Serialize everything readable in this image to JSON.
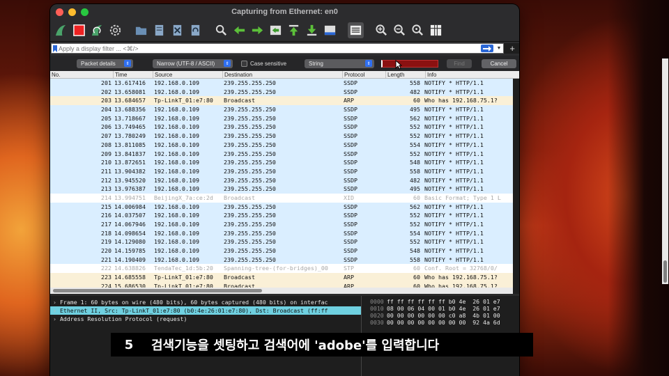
{
  "window": {
    "title": "Capturing from Ethernet: en0"
  },
  "toolbar": {
    "icons": [
      "shark-fin-start-icon",
      "stop-square-icon",
      "shark-fin-restart-icon",
      "gear-options-icon",
      "folder-open-icon",
      "file-save-icon",
      "close-file-icon",
      "reload-icon",
      "search-icon",
      "arrow-back-icon",
      "arrow-forward-icon",
      "go-to-packet-icon",
      "go-first-icon",
      "go-last-icon",
      "autoscroll-icon",
      "colorize-icon",
      "zoom-in-icon",
      "zoom-out-icon",
      "zoom-normal-icon",
      "resize-columns-icon"
    ]
  },
  "filter": {
    "placeholder": "Apply a display filter ... <⌘/>"
  },
  "find": {
    "search_in": "Packet details",
    "encoding": "Narrow (UTF-8 / ASCII)",
    "case_label": "Case sensitive",
    "search_type": "String",
    "find_label": "Find",
    "cancel_label": "Cancel"
  },
  "columns": [
    "No.",
    "Time",
    "Source",
    "Destination",
    "Protocol",
    "Length",
    "Info"
  ],
  "packets": [
    {
      "no": "201",
      "time": "13.617416",
      "src": "192.168.0.109",
      "dst": "239.255.255.250",
      "proto": "SSDP",
      "len": "558",
      "info": "NOTIFY * HTTP/1.1",
      "kind": "udp"
    },
    {
      "no": "202",
      "time": "13.658081",
      "src": "192.168.0.109",
      "dst": "239.255.255.250",
      "proto": "SSDP",
      "len": "482",
      "info": "NOTIFY * HTTP/1.1",
      "kind": "udp"
    },
    {
      "no": "203",
      "time": "13.684657",
      "src": "Tp-LinkT_01:e7:80",
      "dst": "Broadcast",
      "proto": "ARP",
      "len": "60",
      "info": "Who has 192.168.75.1?",
      "kind": "arp"
    },
    {
      "no": "204",
      "time": "13.688356",
      "src": "192.168.0.109",
      "dst": "239.255.255.250",
      "proto": "SSDP",
      "len": "495",
      "info": "NOTIFY * HTTP/1.1",
      "kind": "udp"
    },
    {
      "no": "205",
      "time": "13.718667",
      "src": "192.168.0.109",
      "dst": "239.255.255.250",
      "proto": "SSDP",
      "len": "562",
      "info": "NOTIFY * HTTP/1.1",
      "kind": "udp"
    },
    {
      "no": "206",
      "time": "13.749465",
      "src": "192.168.0.109",
      "dst": "239.255.255.250",
      "proto": "SSDP",
      "len": "552",
      "info": "NOTIFY * HTTP/1.1",
      "kind": "udp"
    },
    {
      "no": "207",
      "time": "13.780249",
      "src": "192.168.0.109",
      "dst": "239.255.255.250",
      "proto": "SSDP",
      "len": "552",
      "info": "NOTIFY * HTTP/1.1",
      "kind": "udp"
    },
    {
      "no": "208",
      "time": "13.811085",
      "src": "192.168.0.109",
      "dst": "239.255.255.250",
      "proto": "SSDP",
      "len": "554",
      "info": "NOTIFY * HTTP/1.1",
      "kind": "udp"
    },
    {
      "no": "209",
      "time": "13.841837",
      "src": "192.168.0.109",
      "dst": "239.255.255.250",
      "proto": "SSDP",
      "len": "552",
      "info": "NOTIFY * HTTP/1.1",
      "kind": "udp"
    },
    {
      "no": "210",
      "time": "13.872651",
      "src": "192.168.0.109",
      "dst": "239.255.255.250",
      "proto": "SSDP",
      "len": "548",
      "info": "NOTIFY * HTTP/1.1",
      "kind": "udp"
    },
    {
      "no": "211",
      "time": "13.904382",
      "src": "192.168.0.109",
      "dst": "239.255.255.250",
      "proto": "SSDP",
      "len": "558",
      "info": "NOTIFY * HTTP/1.1",
      "kind": "udp"
    },
    {
      "no": "212",
      "time": "13.945520",
      "src": "192.168.0.109",
      "dst": "239.255.255.250",
      "proto": "SSDP",
      "len": "482",
      "info": "NOTIFY * HTTP/1.1",
      "kind": "udp"
    },
    {
      "no": "213",
      "time": "13.976387",
      "src": "192.168.0.109",
      "dst": "239.255.255.250",
      "proto": "SSDP",
      "len": "495",
      "info": "NOTIFY * HTTP/1.1",
      "kind": "udp"
    },
    {
      "no": "214",
      "time": "13.994751",
      "src": "BeijingX_7a:ce:2d",
      "dst": "Broadcast",
      "proto": "XID",
      "len": "60",
      "info": "Basic Format; Type 1 L",
      "kind": "gray"
    },
    {
      "no": "215",
      "time": "14.006984",
      "src": "192.168.0.109",
      "dst": "239.255.255.250",
      "proto": "SSDP",
      "len": "562",
      "info": "NOTIFY * HTTP/1.1",
      "kind": "udp"
    },
    {
      "no": "216",
      "time": "14.037507",
      "src": "192.168.0.109",
      "dst": "239.255.255.250",
      "proto": "SSDP",
      "len": "552",
      "info": "NOTIFY * HTTP/1.1",
      "kind": "udp"
    },
    {
      "no": "217",
      "time": "14.067946",
      "src": "192.168.0.109",
      "dst": "239.255.255.250",
      "proto": "SSDP",
      "len": "552",
      "info": "NOTIFY * HTTP/1.1",
      "kind": "udp"
    },
    {
      "no": "218",
      "time": "14.098654",
      "src": "192.168.0.109",
      "dst": "239.255.255.250",
      "proto": "SSDP",
      "len": "554",
      "info": "NOTIFY * HTTP/1.1",
      "kind": "udp"
    },
    {
      "no": "219",
      "time": "14.129080",
      "src": "192.168.0.109",
      "dst": "239.255.255.250",
      "proto": "SSDP",
      "len": "552",
      "info": "NOTIFY * HTTP/1.1",
      "kind": "udp"
    },
    {
      "no": "220",
      "time": "14.159785",
      "src": "192.168.0.109",
      "dst": "239.255.255.250",
      "proto": "SSDP",
      "len": "548",
      "info": "NOTIFY * HTTP/1.1",
      "kind": "udp"
    },
    {
      "no": "221",
      "time": "14.190409",
      "src": "192.168.0.109",
      "dst": "239.255.255.250",
      "proto": "SSDP",
      "len": "558",
      "info": "NOTIFY * HTTP/1.1",
      "kind": "udp"
    },
    {
      "no": "222",
      "time": "14.638826",
      "src": "TendaTec_1d:5b:20",
      "dst": "Spanning-tree-(for-bridges)_00",
      "proto": "STP",
      "len": "60",
      "info": "Conf. Root = 32768/0/",
      "kind": "gray"
    },
    {
      "no": "223",
      "time": "14.685558",
      "src": "Tp-LinkT_01:e7:80",
      "dst": "Broadcast",
      "proto": "ARP",
      "len": "60",
      "info": "Who has 192.168.75.1?",
      "kind": "arp"
    },
    {
      "no": "224",
      "time": "15.686530",
      "src": "Tp-LinkT_01:e7:80",
      "dst": "Broadcast",
      "proto": "ARP",
      "len": "60",
      "info": "Who has 192.168.75.1?",
      "kind": "arp"
    }
  ],
  "details": [
    {
      "text": "Frame 1: 60 bytes on wire (480 bits), 60 bytes captured (480 bits) on interfac",
      "selected": false
    },
    {
      "text": "Ethernet II, Src: Tp-LinkT_01:e7:80 (b0:4e:26:01:e7:80), Dst: Broadcast (ff:ff",
      "selected": true
    },
    {
      "text": "Address Resolution Protocol (request)",
      "selected": false
    }
  ],
  "bytes": [
    {
      "offset": "0000",
      "hex": "ff ff ff ff ff ff b0 4e  26 01 e7"
    },
    {
      "offset": "0010",
      "hex": "08 00 06 04 00 01 b0 4e  26 01 e7"
    },
    {
      "offset": "0020",
      "hex": "00 00 00 00 00 00 c0 a8  4b 01 00"
    },
    {
      "offset": "0030",
      "hex": "00 00 00 00 00 00 00 00  92 4a 6d"
    }
  ],
  "caption": {
    "step": "5",
    "text": "검색기능을 셋팅하고 검색어에 'adobe'를 입력합니다"
  }
}
